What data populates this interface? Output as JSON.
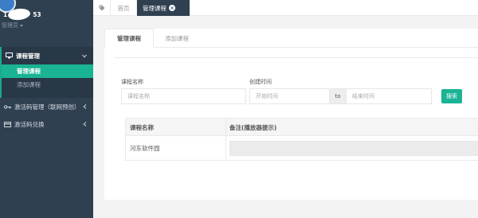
{
  "sidebar": {
    "user": {
      "name_visible": "1",
      "name_tail": "53",
      "role": "管理员"
    },
    "groups": [
      {
        "label": "课程管理",
        "icon": "monitor-icon"
      },
      {
        "label": "激活码管理（联网预创）",
        "icon": "key-icon"
      },
      {
        "label": "激活码兑换",
        "icon": "card-icon"
      }
    ],
    "course_items": [
      "管理课程",
      "添加课程"
    ]
  },
  "topbar": {
    "tabs": [
      {
        "label": "首页"
      },
      {
        "label": "管理课程"
      }
    ]
  },
  "panel": {
    "subtabs": [
      "管理课程",
      "添加课程"
    ],
    "search": {
      "course_name_label": "课程名称",
      "course_name_placeholder": "课程名称",
      "created_time_label": "创建时间",
      "start_placeholder": "开始时间",
      "to_label": "to",
      "end_placeholder": "结束时间",
      "search_button": "搜索"
    },
    "table": {
      "headers": [
        "课程名称",
        "备注(播放器提示)"
      ],
      "rows": [
        {
          "name": "河东软件园",
          "remark": ""
        }
      ]
    }
  },
  "colors": {
    "sidebar_bg": "#2f4050",
    "accent": "#1ab394"
  }
}
